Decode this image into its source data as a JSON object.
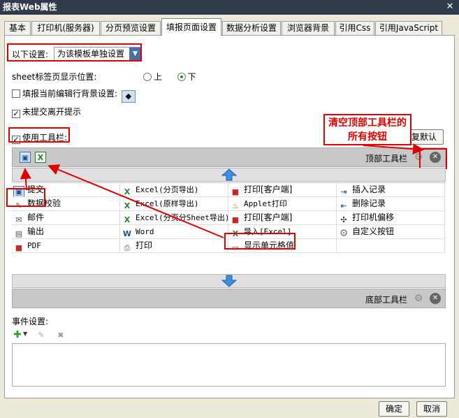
{
  "window": {
    "title": "报表Web属性",
    "close_glyph": "✕"
  },
  "tabs": [
    {
      "label": "基本",
      "active": false
    },
    {
      "label": "打印机(服务器)",
      "active": false
    },
    {
      "label": "分页预览设置",
      "active": false
    },
    {
      "label": "填报页面设置",
      "active": true
    },
    {
      "label": "数据分析设置",
      "active": false
    },
    {
      "label": "浏览器背景",
      "active": false
    },
    {
      "label": "引用Css",
      "active": false
    },
    {
      "label": "引用JavaScript",
      "active": false
    }
  ],
  "settings": {
    "scope_label": "以下设置:",
    "scope_value": "为该模板单独设置",
    "sheet_position_label": "sheet标签页显示位置:",
    "sheet_position_up": "上",
    "sheet_position_down": "下",
    "sheet_position_selected": "下",
    "edit_row_bg_label": "填报当前编辑行背景设置:",
    "unsubmitted_prompt_label": "未提交离开提示",
    "unsubmitted_prompt_checked": true,
    "edit_row_bg_checked": false,
    "use_toolbar_label": "使用工具栏:",
    "use_toolbar_checked": true,
    "restore_default_label": "恢复默认"
  },
  "toolbar": {
    "top_label": "顶部工具栏",
    "bottom_label": "底部工具栏",
    "top_items": [
      "save-icon",
      "excel-icon"
    ]
  },
  "buttons_grid": [
    [
      "提交",
      "Excel(分页导出)",
      "打印[客户端]",
      "插入记录"
    ],
    [
      "数据校验",
      "Excel(原样导出)",
      "Applet打印",
      "删除记录"
    ],
    [
      "邮件",
      "Excel(分页分Sheet导出)",
      "打印[客户端]",
      "打印机偏移"
    ],
    [
      "输出",
      "Word",
      "导入[Excel]",
      "自定义按钮"
    ],
    [
      "PDF",
      "打印",
      "显示单元格值",
      ""
    ]
  ],
  "events": {
    "label": "事件设置:"
  },
  "annotation": {
    "text": "清空顶部工具栏的所有按钮"
  },
  "footer": {
    "ok_label": "确定",
    "cancel_label": "取消"
  },
  "colors": {
    "accent": "#e00000",
    "titlebar": "#2f3a4a",
    "arrow": "#3d8de0"
  }
}
